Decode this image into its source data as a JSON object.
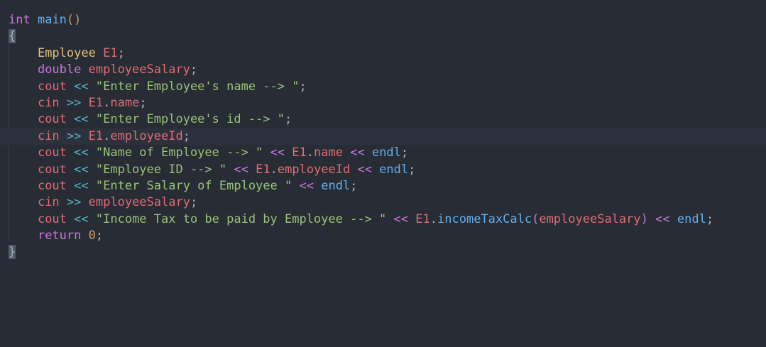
{
  "editor": {
    "theme_colors": {
      "background": "#282c34",
      "active_line": "#2c313c",
      "keyword": "#c678dd",
      "function": "#61afef",
      "type": "#e5c07b",
      "variable": "#e06c75",
      "string": "#98c379",
      "operator": "#56b6c2",
      "number": "#d19a66",
      "text": "#abb2bf"
    },
    "active_line_index": 7,
    "lines": [
      {
        "tokens": [
          [
            "kw",
            "int"
          ],
          [
            "pun",
            " "
          ],
          [
            "fn",
            "main"
          ],
          [
            "paren",
            "()"
          ]
        ]
      },
      {
        "tokens": [
          [
            "brace",
            "{"
          ]
        ]
      },
      {
        "tokens": [
          [
            "pun",
            "    "
          ],
          [
            "type",
            "Employee"
          ],
          [
            "pun",
            " "
          ],
          [
            "var",
            "E1"
          ],
          [
            "pun",
            ";"
          ]
        ]
      },
      {
        "tokens": [
          [
            "pun",
            "    "
          ],
          [
            "kw",
            "double"
          ],
          [
            "pun",
            " "
          ],
          [
            "var",
            "employeeSalary"
          ],
          [
            "pun",
            ";"
          ]
        ]
      },
      {
        "tokens": [
          [
            "pun",
            "    "
          ],
          [
            "var",
            "cout"
          ],
          [
            "pun",
            " "
          ],
          [
            "op",
            "<<"
          ],
          [
            "pun",
            " "
          ],
          [
            "str",
            "\"Enter Employee's name --> \""
          ],
          [
            "pun",
            ";"
          ]
        ]
      },
      {
        "tokens": [
          [
            "pun",
            "    "
          ],
          [
            "var",
            "cin"
          ],
          [
            "pun",
            " "
          ],
          [
            "op",
            ">>"
          ],
          [
            "pun",
            " "
          ],
          [
            "var",
            "E1"
          ],
          [
            "pun",
            "."
          ],
          [
            "var",
            "name"
          ],
          [
            "pun",
            ";"
          ]
        ]
      },
      {
        "tokens": [
          [
            "pun",
            "    "
          ],
          [
            "var",
            "cout"
          ],
          [
            "pun",
            " "
          ],
          [
            "op",
            "<<"
          ],
          [
            "pun",
            " "
          ],
          [
            "str",
            "\"Enter Employee's id --> \""
          ],
          [
            "pun",
            ";"
          ]
        ]
      },
      {
        "tokens": [
          [
            "pun",
            "    "
          ],
          [
            "var",
            "cin"
          ],
          [
            "pun",
            " "
          ],
          [
            "op",
            ">>"
          ],
          [
            "pun",
            " "
          ],
          [
            "var",
            "E1"
          ],
          [
            "pun",
            "."
          ],
          [
            "var",
            "employeeId"
          ],
          [
            "pun",
            ";"
          ]
        ]
      },
      {
        "tokens": [
          [
            "pun",
            "    "
          ],
          [
            "var",
            "cout"
          ],
          [
            "pun",
            " "
          ],
          [
            "op",
            "<<"
          ],
          [
            "pun",
            " "
          ],
          [
            "str",
            "\"Name of Employee --> \""
          ],
          [
            "pun",
            " "
          ],
          [
            "op2",
            "<<"
          ],
          [
            "pun",
            " "
          ],
          [
            "var",
            "E1"
          ],
          [
            "pun",
            "."
          ],
          [
            "var",
            "name"
          ],
          [
            "pun",
            " "
          ],
          [
            "op2",
            "<<"
          ],
          [
            "pun",
            " "
          ],
          [
            "fn",
            "endl"
          ],
          [
            "pun",
            ";"
          ]
        ]
      },
      {
        "tokens": [
          [
            "pun",
            "    "
          ],
          [
            "var",
            "cout"
          ],
          [
            "pun",
            " "
          ],
          [
            "op",
            "<<"
          ],
          [
            "pun",
            " "
          ],
          [
            "str",
            "\"Employee ID --> \""
          ],
          [
            "pun",
            " "
          ],
          [
            "op2",
            "<<"
          ],
          [
            "pun",
            " "
          ],
          [
            "var",
            "E1"
          ],
          [
            "pun",
            "."
          ],
          [
            "var",
            "employeeId"
          ],
          [
            "pun",
            " "
          ],
          [
            "op2",
            "<<"
          ],
          [
            "pun",
            " "
          ],
          [
            "fn",
            "endl"
          ],
          [
            "pun",
            ";"
          ]
        ]
      },
      {
        "tokens": [
          [
            "pun",
            "    "
          ],
          [
            "var",
            "cout"
          ],
          [
            "pun",
            " "
          ],
          [
            "op",
            "<<"
          ],
          [
            "pun",
            " "
          ],
          [
            "str",
            "\"Enter Salary of Employee \""
          ],
          [
            "pun",
            " "
          ],
          [
            "op2",
            "<<"
          ],
          [
            "pun",
            " "
          ],
          [
            "fn",
            "endl"
          ],
          [
            "pun",
            ";"
          ]
        ]
      },
      {
        "tokens": [
          [
            "pun",
            "    "
          ],
          [
            "var",
            "cin"
          ],
          [
            "pun",
            " "
          ],
          [
            "op",
            ">>"
          ],
          [
            "pun",
            " "
          ],
          [
            "var",
            "employeeSalary"
          ],
          [
            "pun",
            ";"
          ]
        ]
      },
      {
        "tokens": [
          [
            "pun",
            "    "
          ],
          [
            "var",
            "cout"
          ],
          [
            "pun",
            " "
          ],
          [
            "op",
            "<<"
          ],
          [
            "pun",
            " "
          ],
          [
            "str",
            "\"Income Tax to be paid by Employee --> \""
          ],
          [
            "pun",
            " "
          ],
          [
            "op2",
            "<<"
          ],
          [
            "pun",
            " "
          ],
          [
            "var",
            "E1"
          ],
          [
            "pun",
            "."
          ],
          [
            "fn",
            "incomeTaxCalc"
          ],
          [
            "op2",
            "("
          ],
          [
            "var",
            "employeeSalary"
          ],
          [
            "op2",
            ")"
          ],
          [
            "pun",
            " "
          ],
          [
            "op2",
            "<<"
          ],
          [
            "pun",
            " "
          ],
          [
            "fn",
            "endl"
          ],
          [
            "pun",
            ";"
          ]
        ]
      },
      {
        "tokens": [
          [
            "pun",
            "    "
          ],
          [
            "kw",
            "return"
          ],
          [
            "pun",
            " "
          ],
          [
            "num",
            "0"
          ],
          [
            "pun",
            ";"
          ]
        ]
      },
      {
        "tokens": [
          [
            "brace",
            "}"
          ]
        ]
      }
    ]
  }
}
